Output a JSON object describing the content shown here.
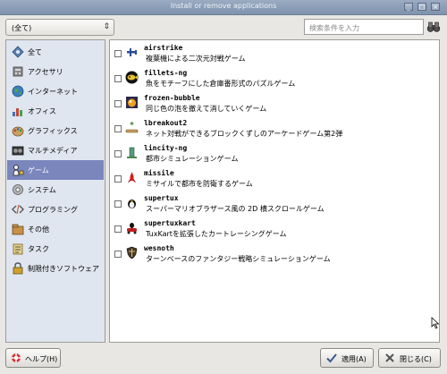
{
  "window": {
    "title": "Install or remove applications"
  },
  "toolbar": {
    "category_select_value": "(全て)",
    "search_placeholder": "検索条件を入力"
  },
  "sidebar": {
    "items": [
      {
        "label": "全て",
        "icon": "all-apps-icon",
        "selected": false
      },
      {
        "label": "アクセサリ",
        "icon": "accessories-icon",
        "selected": false
      },
      {
        "label": "インターネット",
        "icon": "internet-globe-icon",
        "selected": false
      },
      {
        "label": "オフィス",
        "icon": "office-icon",
        "selected": false
      },
      {
        "label": "グラフィックス",
        "icon": "graphics-icon",
        "selected": false
      },
      {
        "label": "マルチメディア",
        "icon": "multimedia-icon",
        "selected": false
      },
      {
        "label": "ゲーム",
        "icon": "games-icon",
        "selected": true
      },
      {
        "label": "システム",
        "icon": "system-icon",
        "selected": false
      },
      {
        "label": "プログラミング",
        "icon": "programming-icon",
        "selected": false
      },
      {
        "label": "その他",
        "icon": "other-icon",
        "selected": false
      },
      {
        "label": "タスク",
        "icon": "tasks-icon",
        "selected": false
      },
      {
        "label": "制限付きソフトウェア",
        "icon": "restricted-software-icon",
        "selected": false
      }
    ]
  },
  "apps": [
    {
      "name": "airstrike",
      "description": "複葉機による二次元対戦ゲーム",
      "icon": "biplane-icon",
      "checked": false
    },
    {
      "name": "fillets-ng",
      "description": "魚をモチーフにした倉庫番形式のパズルゲーム",
      "icon": "fish-icon",
      "checked": false
    },
    {
      "name": "frozen-bubble",
      "description": "同じ色の泡を撤えて消していくゲーム",
      "icon": "bubble-icon",
      "checked": false
    },
    {
      "name": "lbreakout2",
      "description": "ネット対戦ができるブロックくずしのアーケードゲーム第2弾",
      "icon": "paddle-icon",
      "checked": false
    },
    {
      "name": "lincity-ng",
      "description": "都市シミュレーションゲーム",
      "icon": "city-tower-icon",
      "checked": false
    },
    {
      "name": "missile",
      "description": "ミサイルで都市を防衛するゲーム",
      "icon": "missile-icon",
      "checked": false
    },
    {
      "name": "supertux",
      "description": "スーパーマリオブラザース風の 2D 横スクロールゲーム",
      "icon": "penguin-icon",
      "checked": false
    },
    {
      "name": "supertuxkart",
      "description": "TuxKartを拡張したカートレーシングゲーム",
      "icon": "kart-icon",
      "checked": false
    },
    {
      "name": "wesnoth",
      "description": "ターンベースのファンタジー戦略シミュレーションゲーム",
      "icon": "shield-icon",
      "checked": false
    }
  ],
  "buttons": {
    "help": "ヘルプ(H)",
    "apply": "適用(A)",
    "close": "閉じる(C)"
  },
  "colors": {
    "selection": "#7a86bc",
    "sidebar_bg": "#dfe6f0",
    "titlebar": "#8c9fb7"
  }
}
